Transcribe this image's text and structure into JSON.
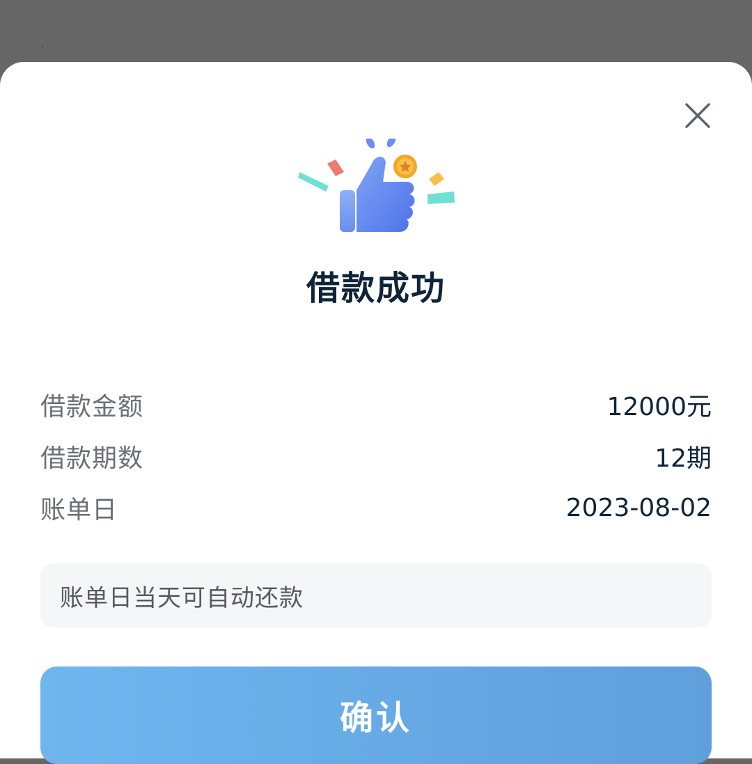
{
  "overlay": {
    "background_color": "#666666"
  },
  "dialog": {
    "close_icon": "close-icon",
    "illustration_icon": "thumbs-up-icon",
    "title": "借款成功",
    "details": [
      {
        "label": "借款金额",
        "value": "12000元"
      },
      {
        "label": "借款期数",
        "value": "12期"
      },
      {
        "label": "账单日",
        "value": "2023-08-02"
      }
    ],
    "notice": "账单日当天可自动还款",
    "confirm_label": "确认"
  },
  "colors": {
    "title_text": "#0f2437",
    "label_text": "#6b6f78",
    "button_gradient_start": "#6fb6ef",
    "button_gradient_end": "#5f9fdc",
    "thumb_blue": "#5b7ff0",
    "coin_orange": "#f5a623"
  }
}
